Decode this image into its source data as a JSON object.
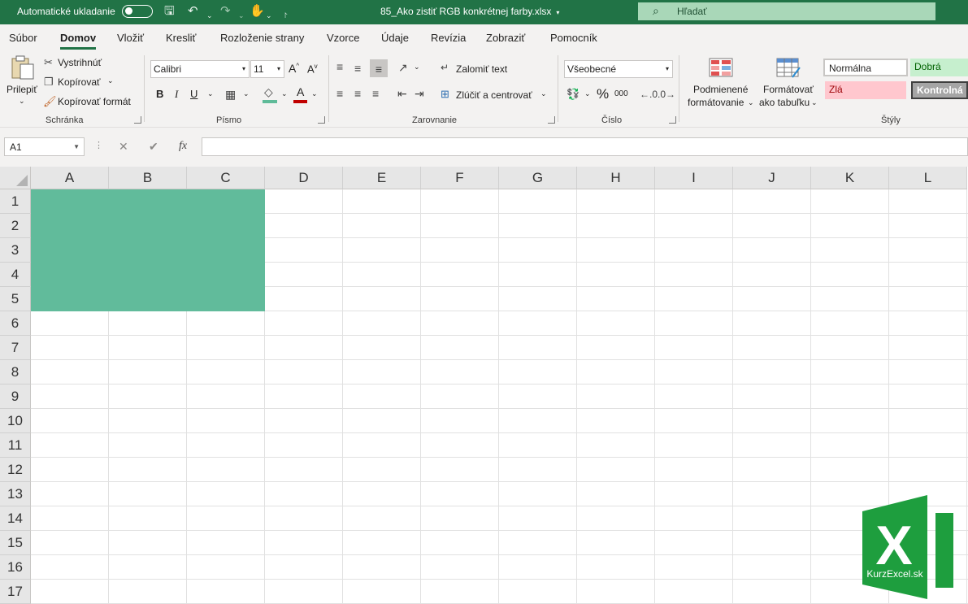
{
  "titlebar": {
    "autosave_label": "Automatické ukladanie",
    "document_title": "85_Ako zistiť RGB konkrétnej farby.xlsx",
    "search_placeholder": "Hľadať"
  },
  "menu_tabs": [
    "Súbor",
    "Domov",
    "Vložiť",
    "Kresliť",
    "Rozloženie strany",
    "Vzorce",
    "Údaje",
    "Revízia",
    "Zobraziť",
    "Pomocník"
  ],
  "active_tab": "Domov",
  "ribbon": {
    "clipboard": {
      "paste": "Prilepiť",
      "cut": "Vystrihnúť",
      "copy": "Kopírovať",
      "format_painter": "Kopírovať formát",
      "group_label": "Schránka"
    },
    "font": {
      "font_name": "Calibri",
      "font_size": "11",
      "bold": "B",
      "italic": "I",
      "underline": "U",
      "group_label": "Písmo",
      "fill_color": "#5fbb99",
      "font_color": "#c00000"
    },
    "alignment": {
      "wrap_text": "Zalomiť text",
      "merge_center": "Zlúčiť a centrovať",
      "group_label": "Zarovnanie"
    },
    "number": {
      "format": "Všeobecné",
      "percent": "%",
      "thousands": "000",
      "group_label": "Číslo"
    },
    "styles": {
      "conditional_formatting_line1": "Podmienené",
      "conditional_formatting_line2": "formátovanie",
      "format_as_table_line1": "Formátovať",
      "format_as_table_line2": "ako tabuľku",
      "normal": "Normálna",
      "good": "Dobrá",
      "bad": "Zlá",
      "check": "Kontrolná",
      "group_label": "Štýly"
    }
  },
  "formula_bar": {
    "name_box": "A1",
    "fx": "fx",
    "formula": ""
  },
  "sheet": {
    "columns": [
      "A",
      "B",
      "C",
      "D",
      "E",
      "F",
      "G",
      "H",
      "I",
      "J",
      "K",
      "L"
    ],
    "rows": [
      "1",
      "2",
      "3",
      "4",
      "5",
      "6",
      "7",
      "8",
      "9",
      "10",
      "11",
      "12",
      "13",
      "14",
      "15",
      "16",
      "17"
    ],
    "filled_range": "A1:C5",
    "fill_color": "#61bb9b"
  },
  "watermark": {
    "letter": "X",
    "text": "KurzExcel.sk",
    "color": "#1e9e3e"
  }
}
